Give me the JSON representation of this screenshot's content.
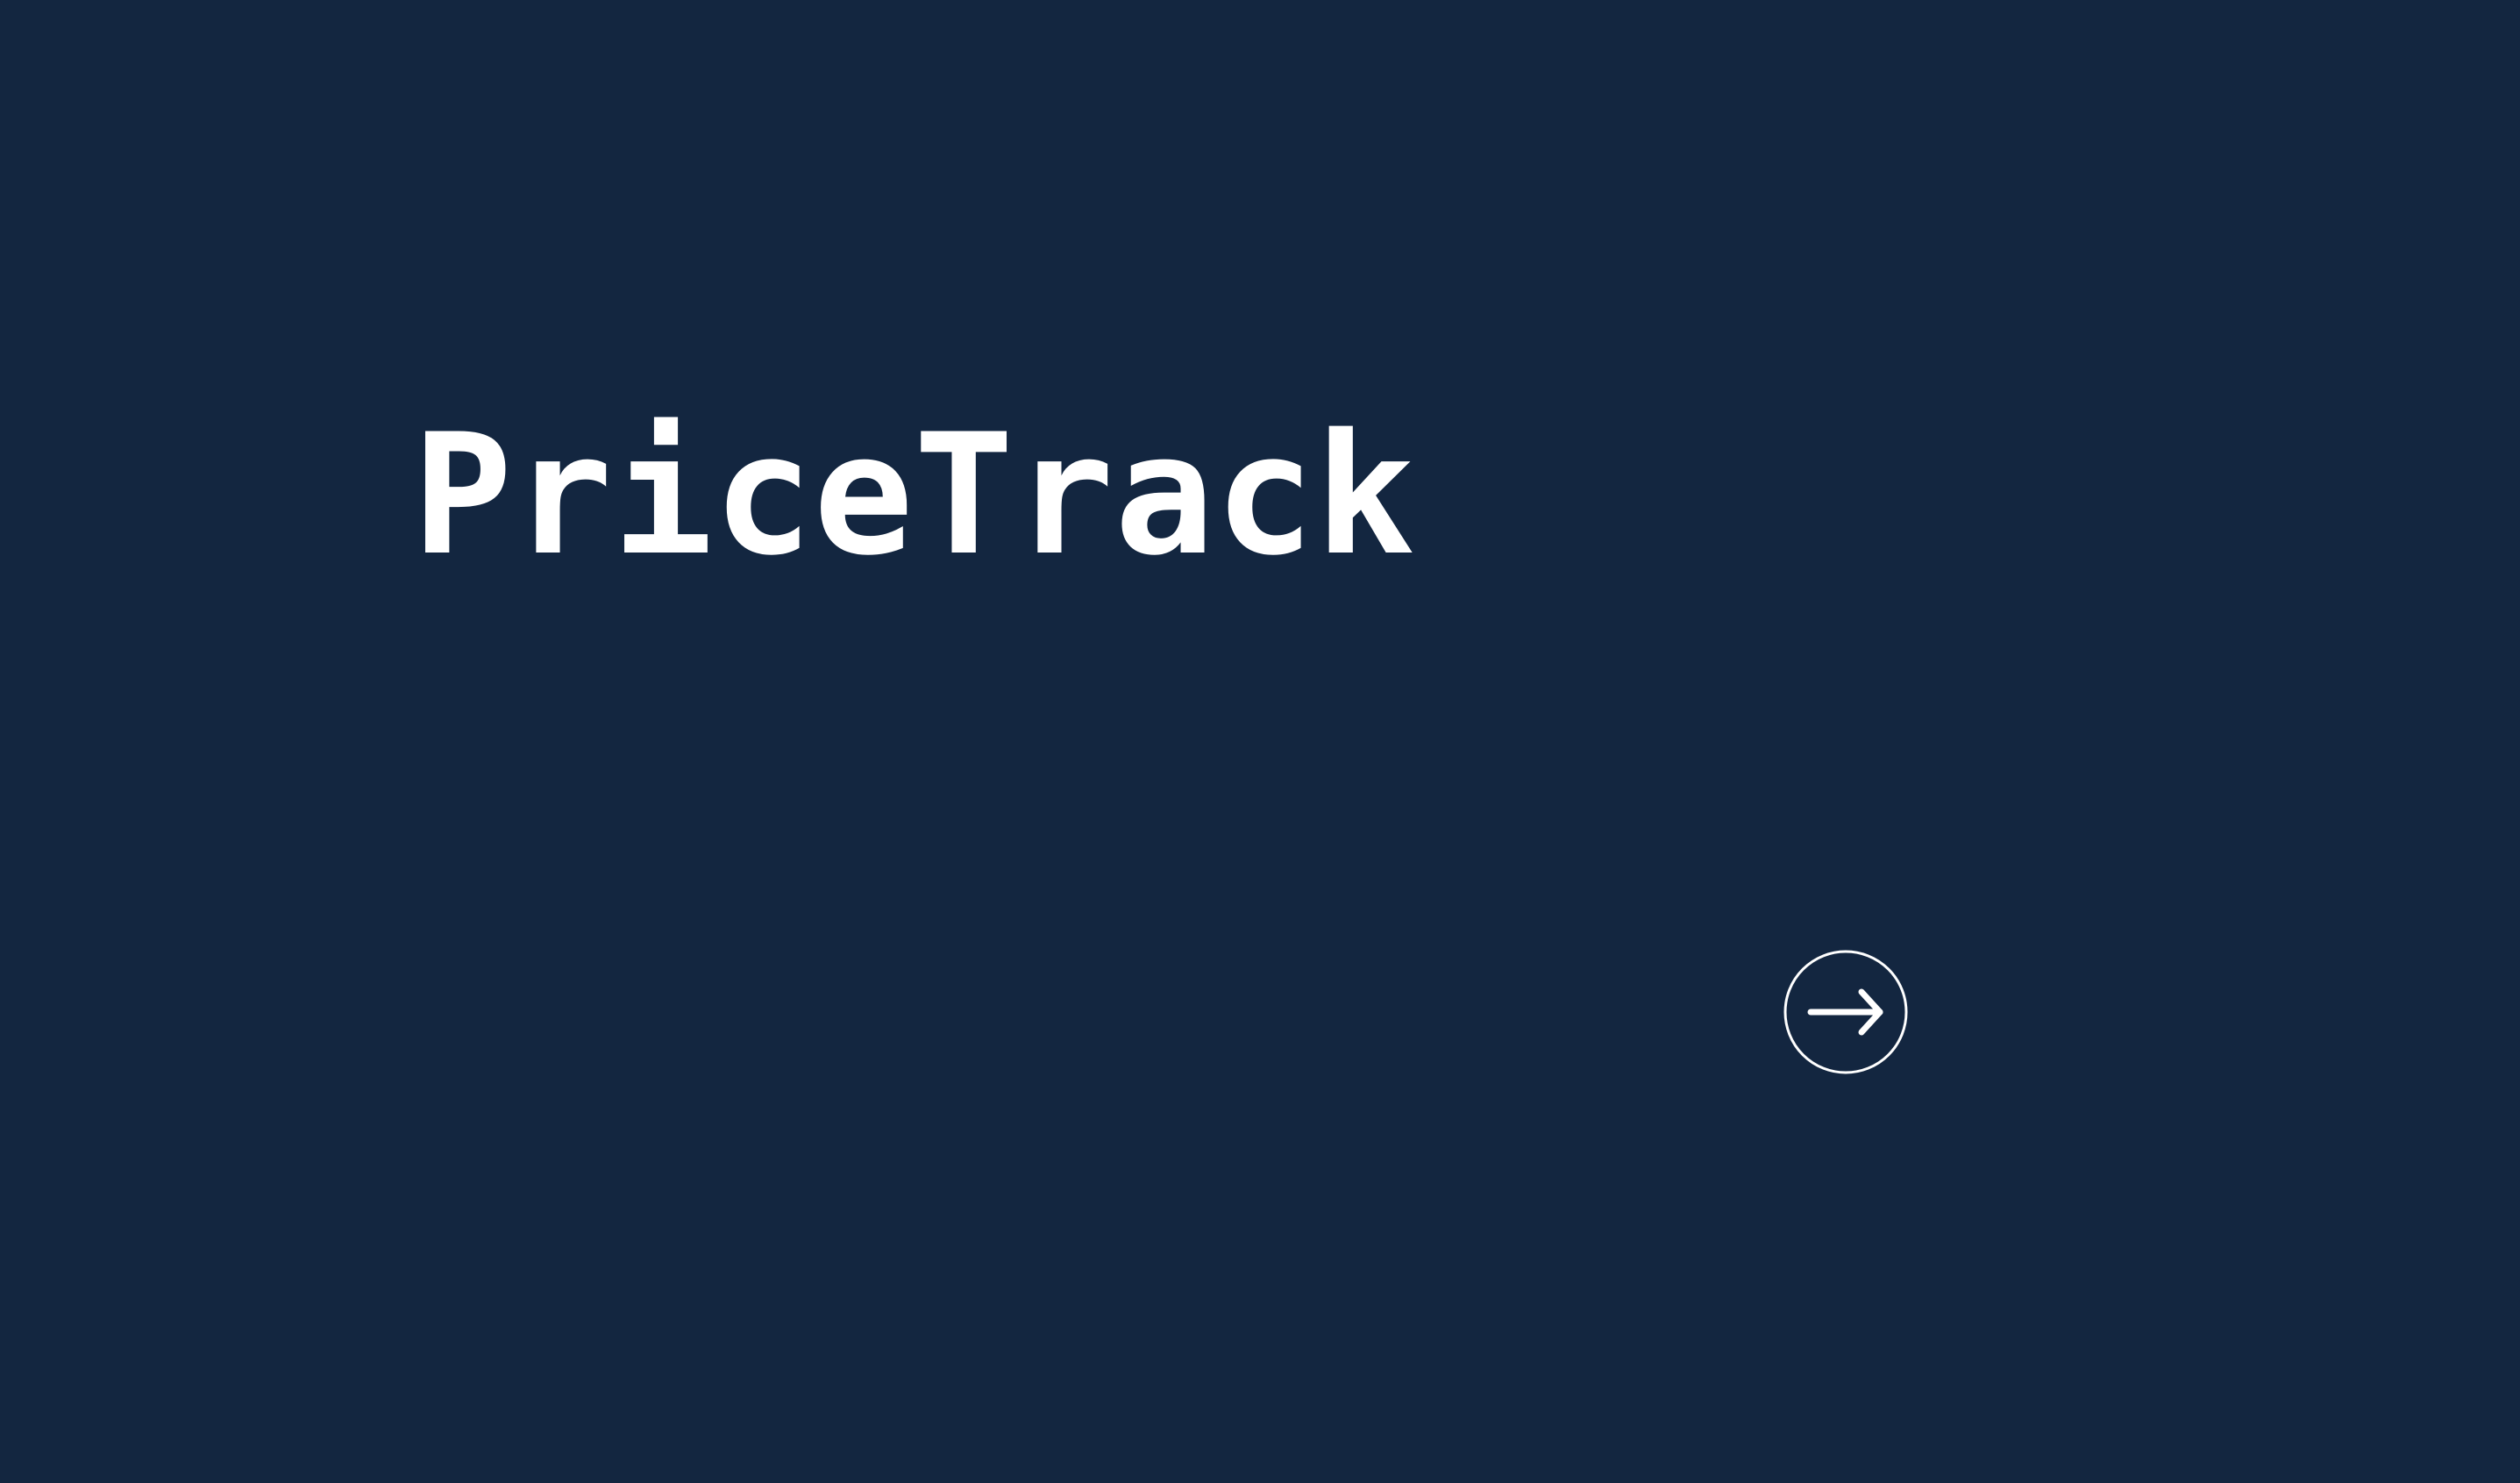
{
  "app": {
    "title": "PriceTrack"
  },
  "actions": {
    "next_icon": "arrow-right-circle-icon"
  },
  "colors": {
    "background": "#132640",
    "foreground": "#ffffff"
  }
}
